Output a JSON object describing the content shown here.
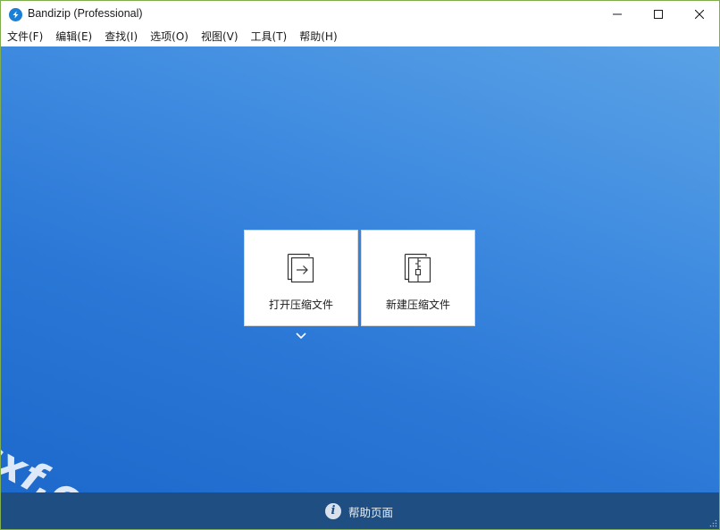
{
  "window": {
    "title": "Bandizip (Professional)"
  },
  "menu": {
    "items": [
      {
        "label": "文件(F)"
      },
      {
        "label": "编辑(E)"
      },
      {
        "label": "查找(I)"
      },
      {
        "label": "选项(O)"
      },
      {
        "label": "视图(V)"
      },
      {
        "label": "工具(T)"
      },
      {
        "label": "帮助(H)"
      }
    ]
  },
  "main": {
    "open_archive_label": "打开压缩文件",
    "new_archive_label": "新建压缩文件"
  },
  "footer": {
    "help_label": "帮助页面",
    "help_icon_glyph": "i"
  },
  "watermark": {
    "text": "cxf.com"
  },
  "colors": {
    "accent": "#1a7fd6",
    "footer_bg": "#1f4f82",
    "main_gradient_top": "#5aa2e6",
    "main_gradient_bottom": "#1d69cc"
  }
}
